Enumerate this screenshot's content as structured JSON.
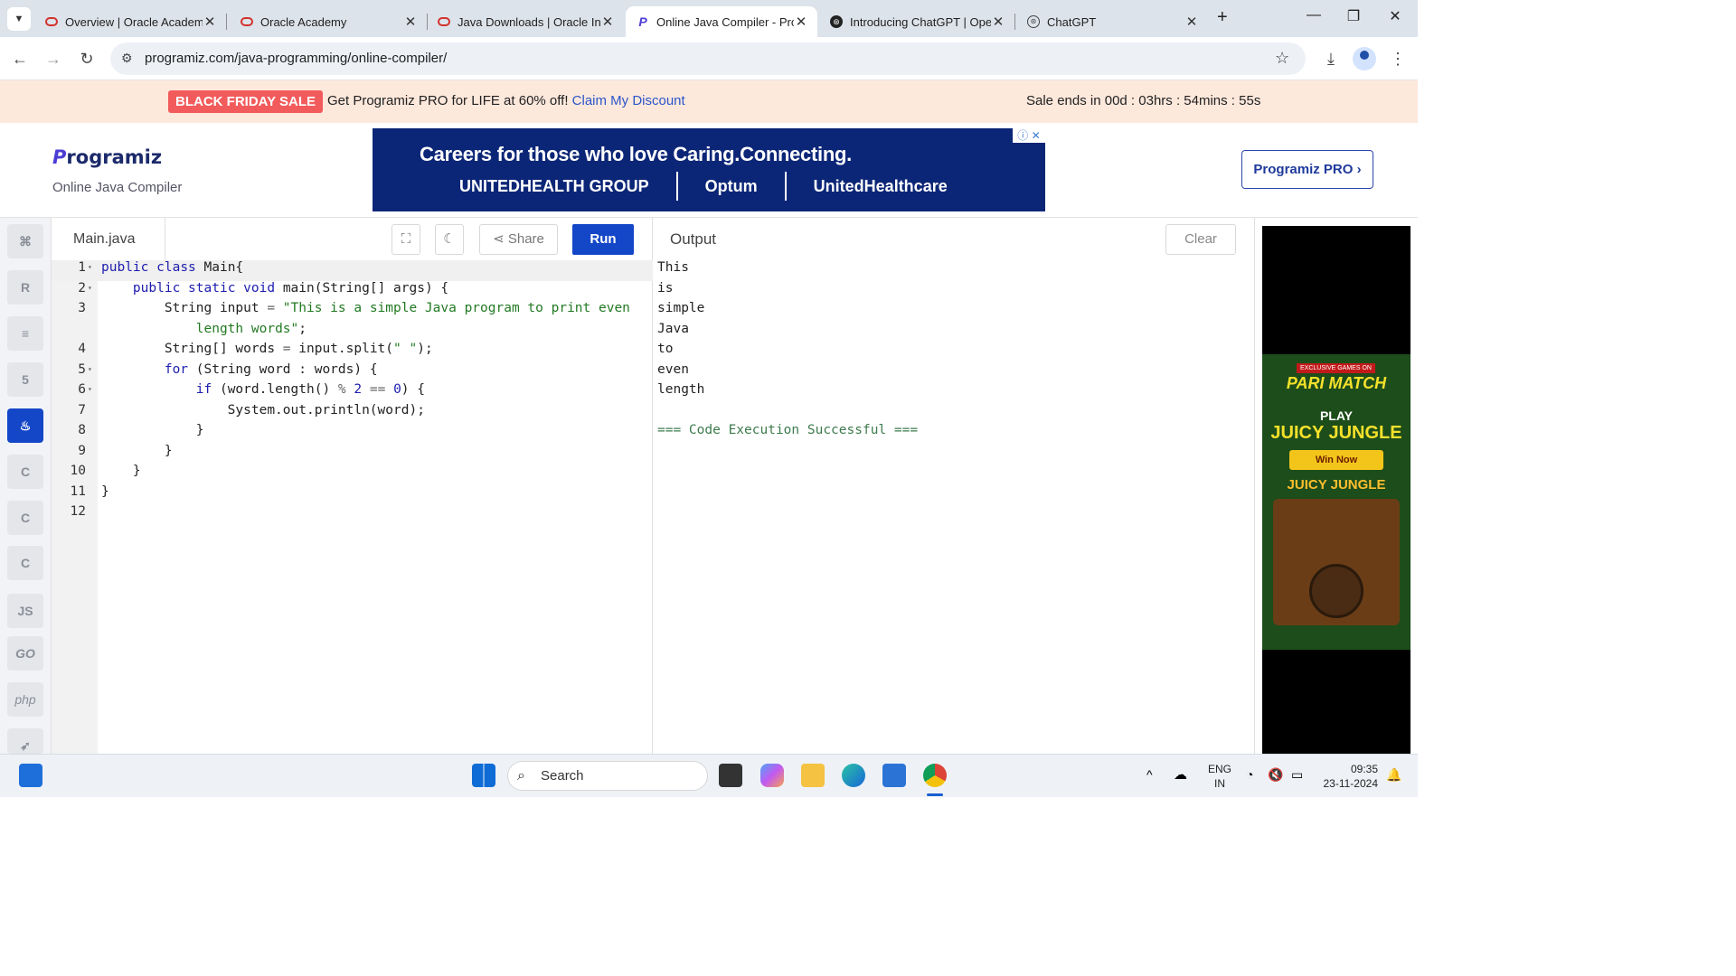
{
  "browser": {
    "tabs": [
      {
        "title": "Overview | Oracle Academy",
        "favicon": "oracle-icon"
      },
      {
        "title": "Oracle Academy",
        "favicon": "oracle-icon"
      },
      {
        "title": "Java Downloads | Oracle In",
        "favicon": "oracle-icon"
      },
      {
        "title": "Online Java Compiler - Pro",
        "favicon": "programiz-icon",
        "active": true
      },
      {
        "title": "Introducing ChatGPT | Ope",
        "favicon": "openai-icon"
      },
      {
        "title": "ChatGPT",
        "favicon": "chatgpt-icon"
      }
    ],
    "url": "programiz.com/java-programming/online-compiler/"
  },
  "promo": {
    "badge": "BLACK FRIDAY SALE",
    "text": "Get Programiz PRO for LIFE at 60% off!",
    "link": "Claim My Discount",
    "countdown": "Sale ends in 00d : 03hrs : 54mins : 55s"
  },
  "header": {
    "logo_p": "P",
    "logo_rest": "rogramiz",
    "subtitle": "Online Java Compiler",
    "pro_button": "Programiz PRO ›",
    "ad": {
      "line1": "Careers for those who love Caring.Connecting.",
      "brand1": "UNITEDHEALTH GROUP",
      "brand2": "Optum",
      "brand3": "UnitedHealthcare"
    }
  },
  "sidebar": {
    "languages": [
      "python",
      "r",
      "sql",
      "html",
      "java",
      "c",
      "cpp",
      "csharp",
      "JS",
      "GO",
      "php",
      "swift"
    ],
    "active": "java"
  },
  "editor": {
    "filename": "Main.java",
    "share_label": "Share",
    "run_label": "Run",
    "line_numbers": [
      "1",
      "2",
      "3",
      "",
      "4",
      "5",
      "6",
      "7",
      "8",
      "9",
      "10",
      "11",
      "12"
    ]
  },
  "output": {
    "title": "Output",
    "clear_label": "Clear",
    "lines": [
      "This",
      "is",
      "simple",
      "Java",
      "to",
      "even",
      "length",
      "",
      "=== Code Execution Successful ==="
    ]
  },
  "side_ad": {
    "exclusive": "EXCLUSIVE GAMES ON",
    "brand": "PARI MATCH",
    "play": "PLAY",
    "title": "JUICY JUNGLE",
    "cta": "Win Now",
    "logo": "JUICY JUNGLE"
  },
  "taskbar": {
    "search_placeholder": "Search",
    "lang_line1": "ENG",
    "lang_line2": "IN",
    "time": "09:35",
    "date": "23-11-2024"
  }
}
